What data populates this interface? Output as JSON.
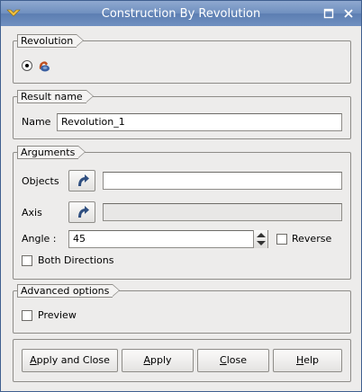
{
  "window": {
    "title": "Construction By Revolution"
  },
  "groups": {
    "revolution": {
      "label": "Revolution"
    },
    "result_name": {
      "label": "Result name",
      "name_label": "Name",
      "name_value": "Revolution_1"
    },
    "arguments": {
      "label": "Arguments",
      "objects_label": "Objects",
      "objects_value": "",
      "axis_label": "Axis",
      "axis_value": "",
      "angle_label": "Angle :",
      "angle_value": "45",
      "reverse_label": "Reverse",
      "reverse_checked": false,
      "both_directions_label": "Both Directions",
      "both_directions_checked": false
    },
    "advanced": {
      "label": "Advanced options",
      "preview_label": "Preview",
      "preview_checked": false
    }
  },
  "buttons": {
    "apply_close": {
      "first": "A",
      "rest": "pply and Close"
    },
    "apply": {
      "first": "A",
      "rest": "pply"
    },
    "close": {
      "first": "C",
      "rest": "lose"
    },
    "help": {
      "first": "H",
      "rest": "elp"
    }
  },
  "icons": {
    "app": "app-logo-icon",
    "maximize": "maximize-icon",
    "close": "close-icon",
    "revolution": "revolution-icon",
    "select": "select-arrow-icon"
  }
}
